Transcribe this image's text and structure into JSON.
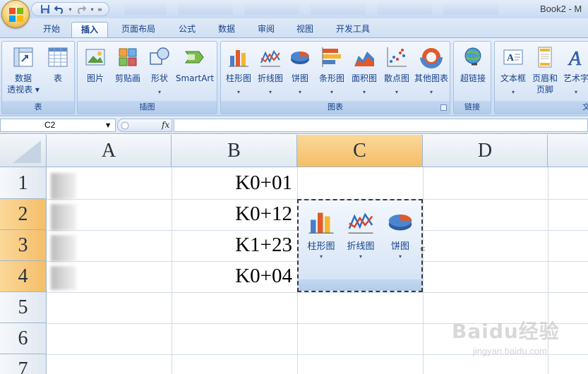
{
  "window": {
    "title": "Book2 - M"
  },
  "office_button": {
    "icon": "office-logo-icon"
  },
  "quick_access": {
    "icons": [
      "save-icon",
      "undo-icon",
      "redo-icon",
      "customize-qat-icon"
    ]
  },
  "ribbon_tabs": [
    {
      "label": "开始"
    },
    {
      "label": "插入",
      "active": true
    },
    {
      "label": "页面布局"
    },
    {
      "label": "公式"
    },
    {
      "label": "数据"
    },
    {
      "label": "审阅"
    },
    {
      "label": "视图"
    },
    {
      "label": "开发工具"
    }
  ],
  "groups": {
    "table": {
      "label": "表",
      "pivot_line1": "数据",
      "pivot_line2": "透视表",
      "table": "表"
    },
    "illustrations": {
      "label": "插图",
      "picture": "图片",
      "clipart": "剪贴画",
      "shapes": "形状",
      "smartart": "SmartArt"
    },
    "charts": {
      "label": "图表",
      "column": "柱形图",
      "line": "折线图",
      "pie": "饼图",
      "bar": "条形图",
      "area": "面积图",
      "scatter": "散点图",
      "other": "其他图表"
    },
    "links": {
      "label": "链接",
      "hyperlink": "超链接"
    },
    "text": {
      "label": "文",
      "textbox": "文本框",
      "header_line1": "页眉和",
      "header_line2": "页脚",
      "wordart": "艺术字"
    }
  },
  "formula_bar": {
    "name_box": "C2",
    "fx": "fx",
    "value": ""
  },
  "columns": [
    "A",
    "B",
    "C",
    "D"
  ],
  "rows": [
    "1",
    "2",
    "3",
    "4",
    "5",
    "6",
    "7"
  ],
  "cells": {
    "B1": "K0+01",
    "B2": "K0+12",
    "B3": "K1+23",
    "B4": "K0+04"
  },
  "selection": {
    "column": "C",
    "rows": [
      "2",
      "3",
      "4"
    ]
  },
  "floating_gallery": {
    "column": "柱形图",
    "line": "折线图",
    "pie": "饼图"
  },
  "watermark": {
    "main": "Baidu经验",
    "sub": "jingyan.baidu.com"
  },
  "colors": {
    "ribbon_text": "#15428b",
    "selected_header": "#f4be67",
    "ribbon_bg": "#d6e4f6"
  }
}
